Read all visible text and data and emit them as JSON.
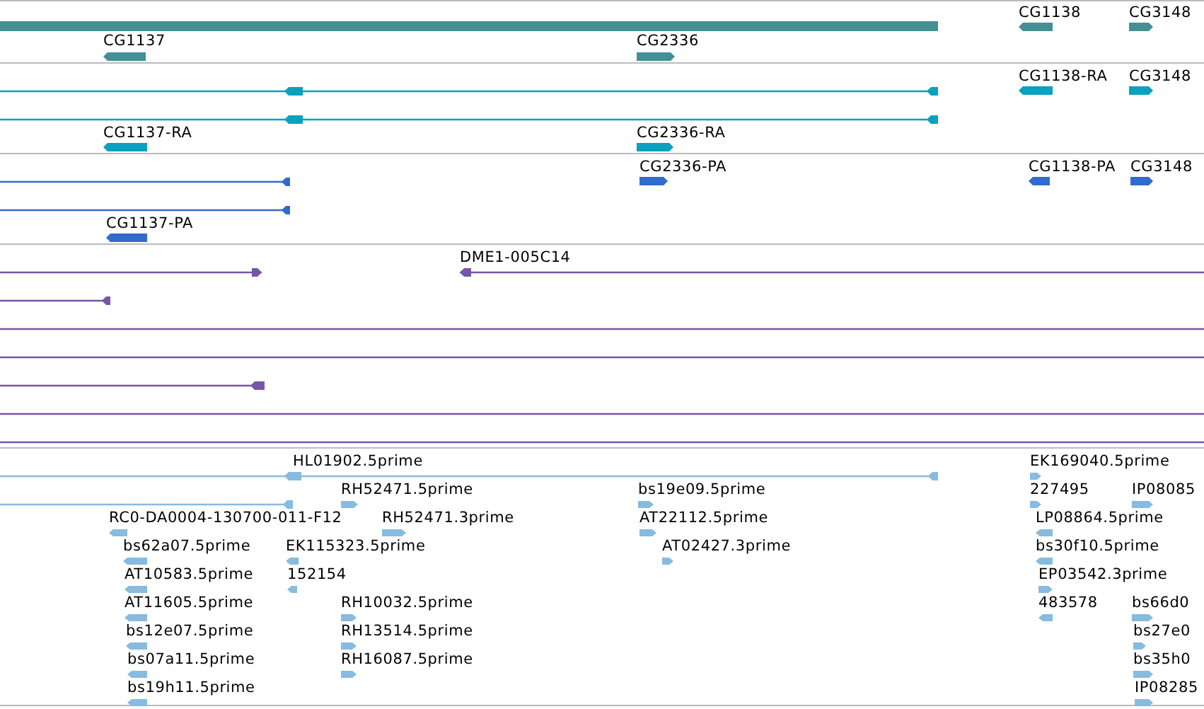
{
  "tracks": [
    {
      "color": "#438f94",
      "features": [
        {
          "kind": "bar"
        },
        {
          "kind": "gene",
          "label": "CG1137",
          "reverse": true
        },
        {
          "kind": "gene",
          "label": "CG2336",
          "reverse": false
        },
        {
          "kind": "gene",
          "label": "CG1138",
          "reverse": true
        },
        {
          "kind": "gene",
          "label": "CG3148",
          "reverse": false
        }
      ]
    },
    {
      "color": "#0aa0bf",
      "features": [
        {
          "kind": "line",
          "reverse": true
        },
        {
          "kind": "line",
          "reverse": true
        },
        {
          "kind": "gene",
          "label": "CG1137-RA",
          "reverse": true
        },
        {
          "kind": "gene",
          "label": "CG2336-RA",
          "reverse": false
        },
        {
          "kind": "gene",
          "label": "CG1138-RA",
          "reverse": true
        },
        {
          "kind": "gene",
          "label": "CG3148",
          "reverse": false
        }
      ]
    },
    {
      "color": "#316bcc",
      "features": [
        {
          "kind": "line",
          "reverse": true
        },
        {
          "kind": "line",
          "reverse": true
        },
        {
          "kind": "gene",
          "label": "CG1137-PA",
          "reverse": true
        },
        {
          "kind": "gene",
          "label": "CG2336-PA",
          "reverse": false
        },
        {
          "kind": "gene",
          "label": "CG1138-PA",
          "reverse": true
        },
        {
          "kind": "gene",
          "label": "CG3148",
          "reverse": false
        }
      ]
    },
    {
      "color": "#7755aa",
      "features": [
        {
          "kind": "line",
          "reverse": false
        },
        {
          "kind": "line",
          "label": "DME1-005C14",
          "reverse": true
        },
        {
          "kind": "line",
          "reverse": true
        },
        {
          "kind": "line"
        },
        {
          "kind": "line"
        },
        {
          "kind": "line",
          "reverse": true
        },
        {
          "kind": "line"
        },
        {
          "kind": "line"
        }
      ]
    },
    {
      "color": "#87bbe0",
      "features": [
        {
          "kind": "line",
          "label": "HL01902.5prime",
          "reverse": true
        },
        {
          "kind": "line",
          "reverse": true
        },
        {
          "kind": "est",
          "label": "RH52471.5prime",
          "reverse": false
        },
        {
          "kind": "est",
          "label": "RC0-DA0004-130700-011-F12",
          "reverse": true
        },
        {
          "kind": "est",
          "label": "RH52471.3prime",
          "reverse": false
        },
        {
          "kind": "est",
          "label": "bs62a07.5prime",
          "reverse": true
        },
        {
          "kind": "est",
          "label": "EK115323.5prime",
          "reverse": true
        },
        {
          "kind": "est",
          "label": "AT10583.5prime",
          "reverse": true
        },
        {
          "kind": "est",
          "label": "152154",
          "reverse": true
        },
        {
          "kind": "est",
          "label": "AT11605.5prime",
          "reverse": true
        },
        {
          "kind": "est",
          "label": "RH10032.5prime",
          "reverse": false
        },
        {
          "kind": "est",
          "label": "bs12e07.5prime",
          "reverse": true
        },
        {
          "kind": "est",
          "label": "RH13514.5prime",
          "reverse": false
        },
        {
          "kind": "est",
          "label": "bs07a11.5prime",
          "reverse": true
        },
        {
          "kind": "est",
          "label": "RH16087.5prime",
          "reverse": false
        },
        {
          "kind": "est",
          "label": "bs19h11.5prime",
          "reverse": true
        },
        {
          "kind": "est",
          "label": "bs19e09.5prime",
          "reverse": false
        },
        {
          "kind": "est",
          "label": "AT22112.5prime",
          "reverse": false
        },
        {
          "kind": "est",
          "label": "AT02427.3prime",
          "reverse": false
        },
        {
          "kind": "est",
          "label": "EK169040.5prime",
          "reverse": false
        },
        {
          "kind": "est",
          "label": "227495",
          "reverse": false
        },
        {
          "kind": "est",
          "label": "IP08085",
          "reverse": false
        },
        {
          "kind": "est",
          "label": "LP08864.5prime",
          "reverse": true
        },
        {
          "kind": "est",
          "label": "bs30f10.5prime",
          "reverse": true
        },
        {
          "kind": "est",
          "label": "EP03542.3prime",
          "reverse": false
        },
        {
          "kind": "est",
          "label": "483578",
          "reverse": true
        },
        {
          "kind": "est",
          "label": "bs66d0",
          "reverse": false
        },
        {
          "kind": "est",
          "label": "bs27e0",
          "reverse": false
        },
        {
          "kind": "est",
          "label": "bs35h0",
          "reverse": false
        },
        {
          "kind": "est",
          "label": "IP08285",
          "reverse": false
        }
      ]
    }
  ]
}
